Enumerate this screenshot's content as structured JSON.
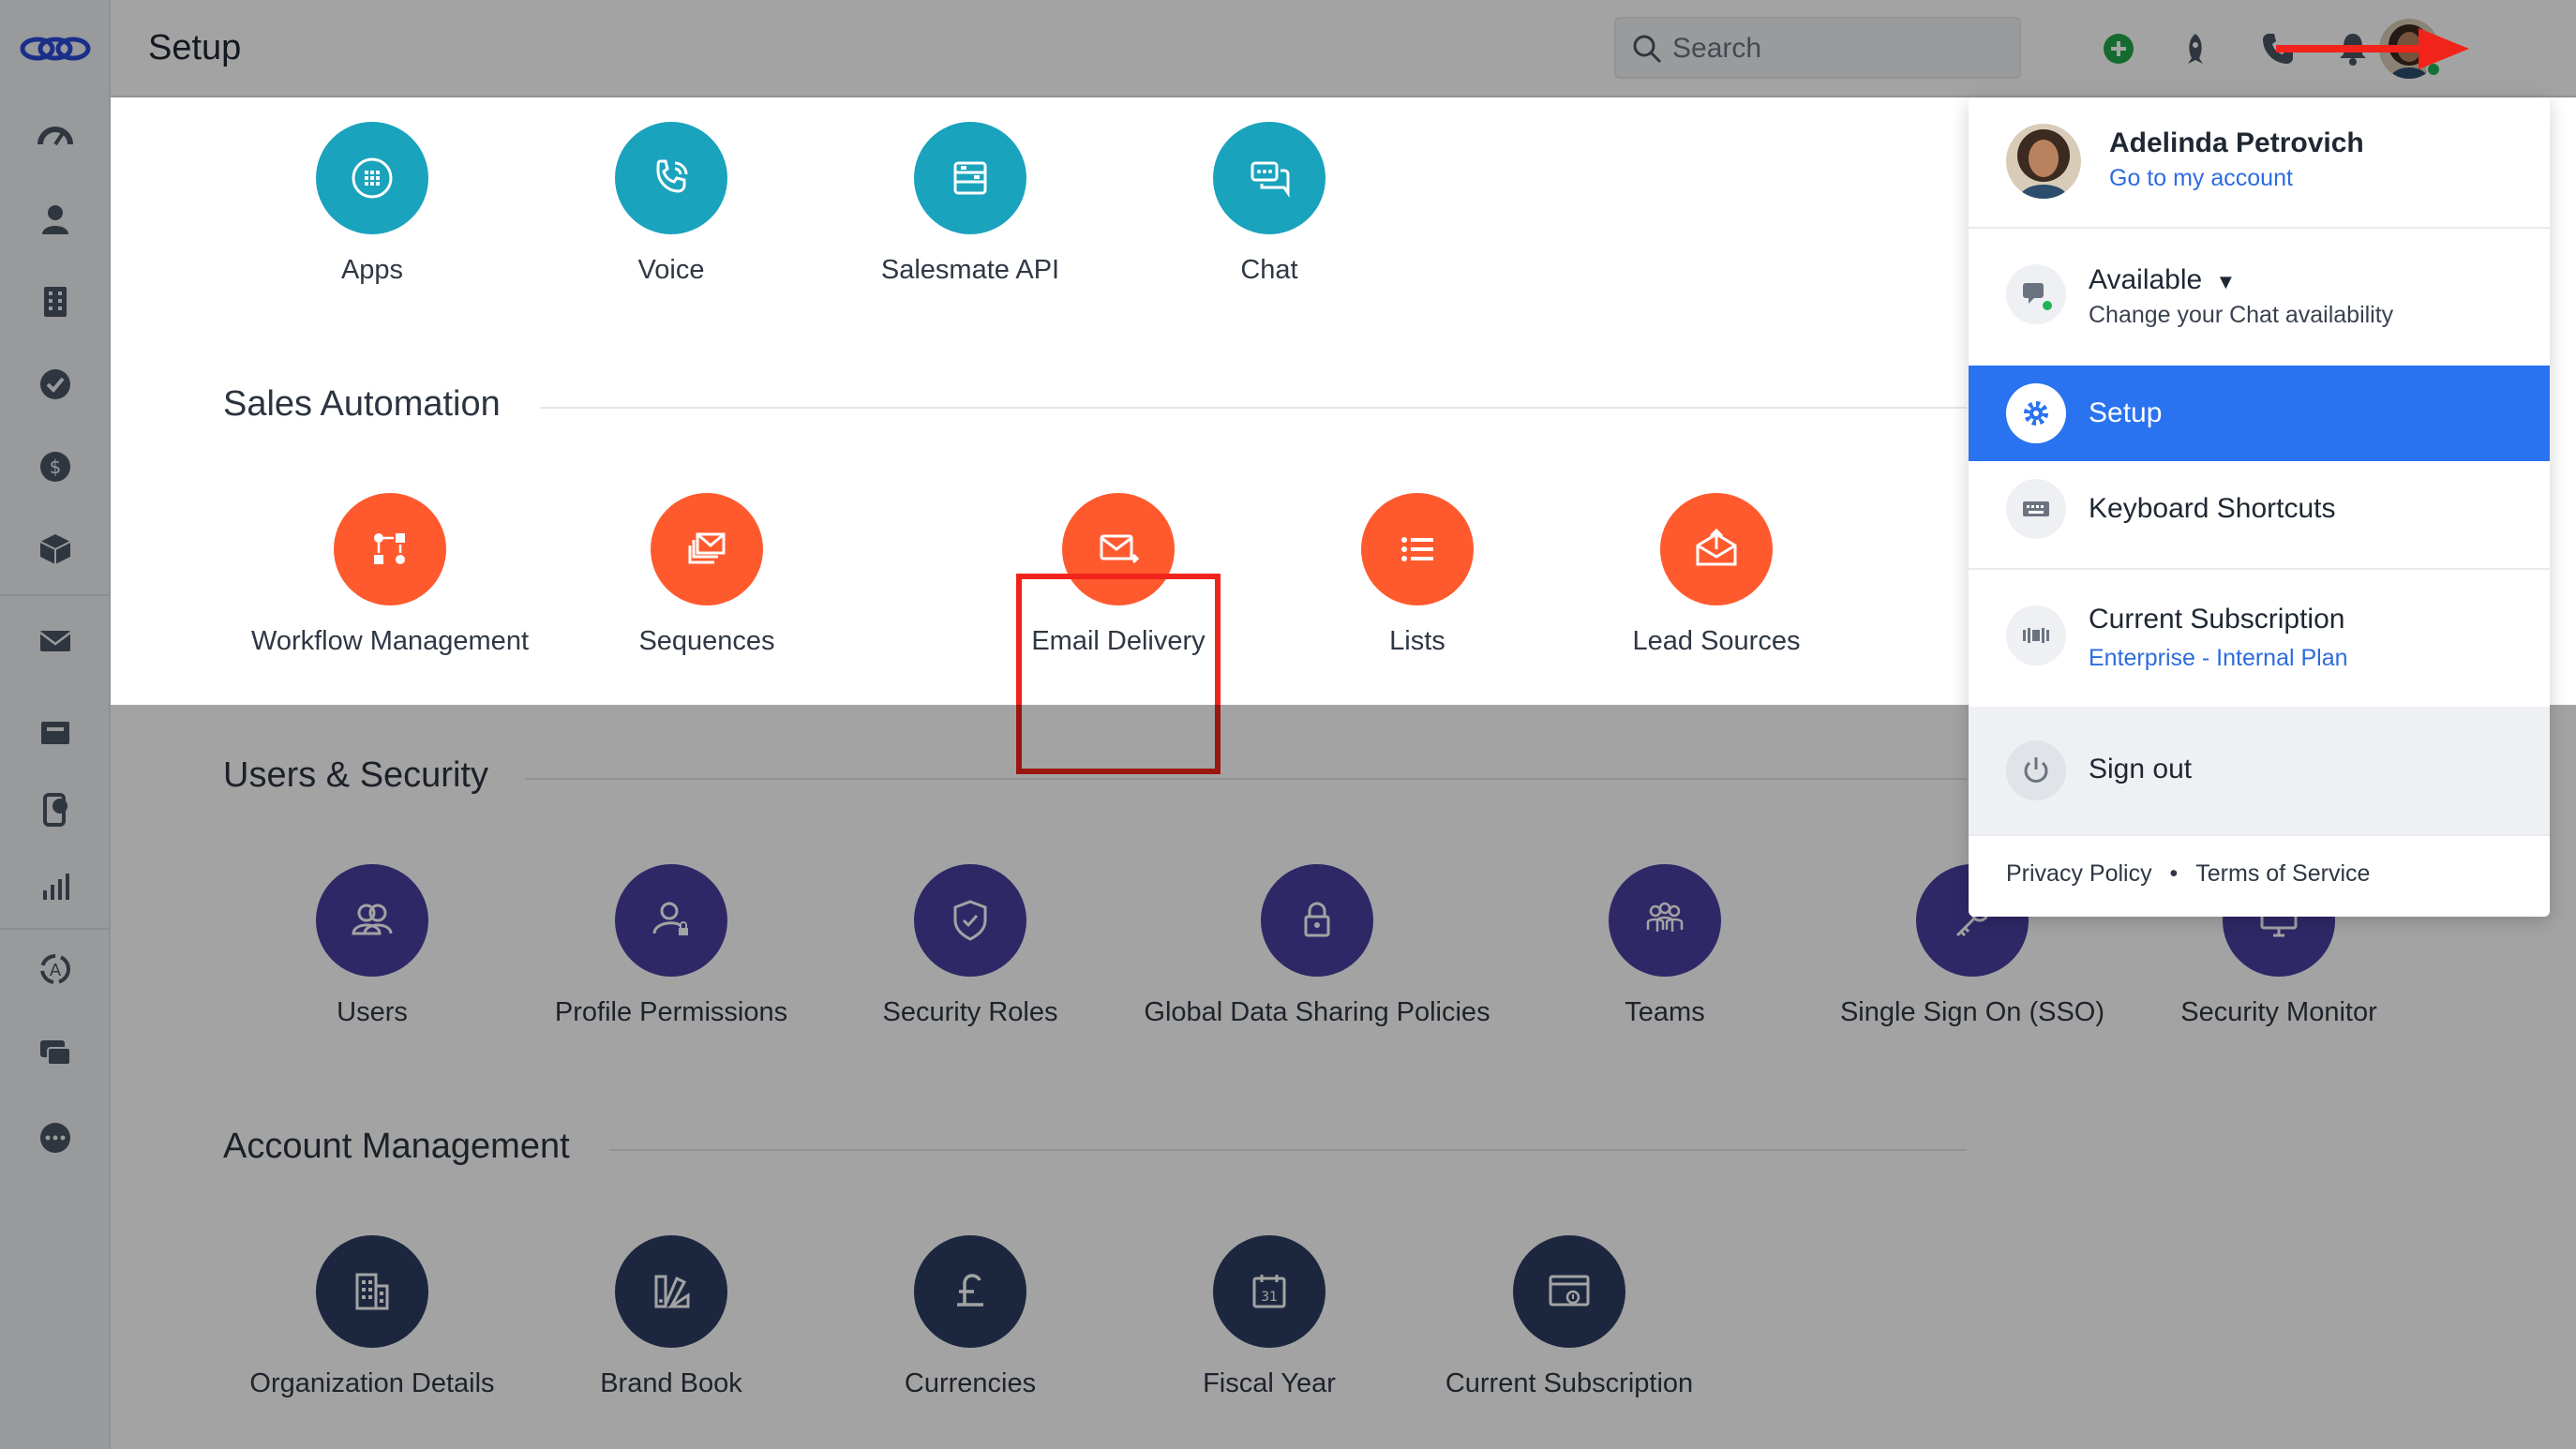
{
  "header": {
    "title": "Setup",
    "search_placeholder": "Search"
  },
  "sections": {
    "top_tiles": [
      {
        "label": "Apps",
        "icon": "apps-icon"
      },
      {
        "label": "Voice",
        "icon": "voice-icon"
      },
      {
        "label": "Salesmate API",
        "icon": "api-icon"
      },
      {
        "label": "Chat",
        "icon": "chat-icon"
      }
    ],
    "sales_automation": {
      "title": "Sales Automation",
      "tiles": [
        {
          "label": "Workflow Management",
          "icon": "workflow-icon"
        },
        {
          "label": "Sequences",
          "icon": "sequences-icon"
        },
        {
          "label": "Email Delivery",
          "icon": "email-delivery-icon"
        },
        {
          "label": "Lists",
          "icon": "lists-icon"
        },
        {
          "label": "Lead Sources",
          "icon": "lead-sources-icon"
        }
      ]
    },
    "users_security": {
      "title": "Users & Security",
      "tiles": [
        {
          "label": "Users",
          "icon": "users-icon"
        },
        {
          "label": "Profile Permissions",
          "icon": "profile-permissions-icon"
        },
        {
          "label": "Security Roles",
          "icon": "security-roles-icon"
        },
        {
          "label": "Global Data Sharing Policies",
          "icon": "lock-icon"
        },
        {
          "label": "Teams",
          "icon": "teams-icon"
        },
        {
          "label": "Single Sign On (SSO)",
          "icon": "key-icon"
        },
        {
          "label": "Security Monitor",
          "icon": "monitor-icon"
        }
      ]
    },
    "account_management": {
      "title": "Account Management",
      "tiles": [
        {
          "label": "Organization Details",
          "icon": "building-icon"
        },
        {
          "label": "Brand Book",
          "icon": "brand-book-icon"
        },
        {
          "label": "Currencies",
          "icon": "pound-icon"
        },
        {
          "label": "Fiscal Year",
          "icon": "calendar-icon"
        },
        {
          "label": "Current Subscription",
          "icon": "subscription-icon"
        }
      ]
    }
  },
  "menu": {
    "user_name": "Adelinda Petrovich",
    "account_link": "Go to my account",
    "availability": "Available",
    "availability_sub": "Change your Chat availability",
    "setup": "Setup",
    "shortcuts": "Keyboard Shortcuts",
    "subscription": "Current Subscription",
    "subscription_plan": "Enterprise - Internal Plan",
    "sign_out": "Sign out",
    "privacy": "Privacy Policy",
    "separator": "•",
    "terms": "Terms of Service"
  },
  "colors": {
    "teal": "#1aa3bd",
    "orange": "#ff5a2e",
    "purple": "#4a3fa1",
    "navy": "#2d3d63",
    "menu_active": "#2a73f0",
    "highlight": "#f2231a"
  }
}
